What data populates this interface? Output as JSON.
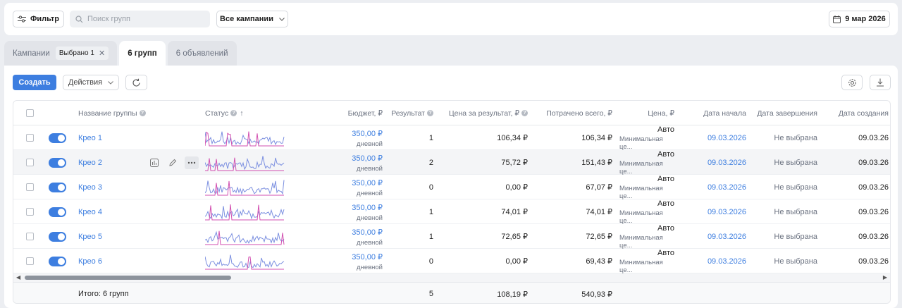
{
  "toolbar": {
    "filter_label": "Фильтр",
    "search_placeholder": "Поиск групп",
    "campaign_select": "Все кампании",
    "date_label": "9 мар 2026"
  },
  "tabs": [
    {
      "label": "Кампании",
      "chip": "Выбрано 1"
    },
    {
      "label": "6 групп"
    },
    {
      "label": "6 объявлений"
    }
  ],
  "panel": {
    "create_label": "Создать",
    "actions_label": "Действия"
  },
  "columns": {
    "name": "Название группы",
    "status": "Статус",
    "budget": "Бюджет, ₽",
    "result": "Результат",
    "cost_per_result": "Цена за результат, ₽",
    "spent": "Потрачено всего, ₽",
    "price": "Цена, ₽",
    "start": "Дата начала",
    "end": "Дата завершения",
    "created": "Дата создания"
  },
  "rows": [
    {
      "name": "Крео 1",
      "budget": "350,00 ₽",
      "budget_period": "дневной",
      "result": "1",
      "cpr": "106,34 ₽",
      "spent": "106,34 ₽",
      "price": "Авто",
      "price_sub": "Минимальная це...",
      "start": "09.03.2026",
      "end": "Не выбрана",
      "created": "09.03.26"
    },
    {
      "name": "Крео 2",
      "budget": "350,00 ₽",
      "budget_period": "дневной",
      "result": "2",
      "cpr": "75,72 ₽",
      "spent": "151,43 ₽",
      "price": "Авто",
      "price_sub": "Минимальная це...",
      "start": "09.03.2026",
      "end": "Не выбрана",
      "created": "09.03.26"
    },
    {
      "name": "Крео 3",
      "budget": "350,00 ₽",
      "budget_period": "дневной",
      "result": "0",
      "cpr": "0,00 ₽",
      "spent": "67,07 ₽",
      "price": "Авто",
      "price_sub": "Минимальная це...",
      "start": "09.03.2026",
      "end": "Не выбрана",
      "created": "09.03.26"
    },
    {
      "name": "Крео 4",
      "budget": "350,00 ₽",
      "budget_period": "дневной",
      "result": "1",
      "cpr": "74,01 ₽",
      "spent": "74,01 ₽",
      "price": "Авто",
      "price_sub": "Минимальная це...",
      "start": "09.03.2026",
      "end": "Не выбрана",
      "created": "09.03.26"
    },
    {
      "name": "Крео 5",
      "budget": "350,00 ₽",
      "budget_period": "дневной",
      "result": "1",
      "cpr": "72,65 ₽",
      "spent": "72,65 ₽",
      "price": "Авто",
      "price_sub": "Минимальная це...",
      "start": "09.03.2026",
      "end": "Не выбрана",
      "created": "09.03.26"
    },
    {
      "name": "Крео 6",
      "budget": "350,00 ₽",
      "budget_period": "дневной",
      "result": "0",
      "cpr": "0,00 ₽",
      "spent": "69,43 ₽",
      "price": "Авто",
      "price_sub": "Минимальная це...",
      "start": "09.03.2026",
      "end": "Не выбрана",
      "created": "09.03.26"
    }
  ],
  "totals": {
    "label": "Итого: 6 групп",
    "result": "5",
    "cpr": "108,19 ₽",
    "spent": "540,93 ₽"
  },
  "colors": {
    "accent": "#3d7ee0",
    "spark_blue": "#7b8fe0",
    "spark_pink": "#d24fb0"
  }
}
